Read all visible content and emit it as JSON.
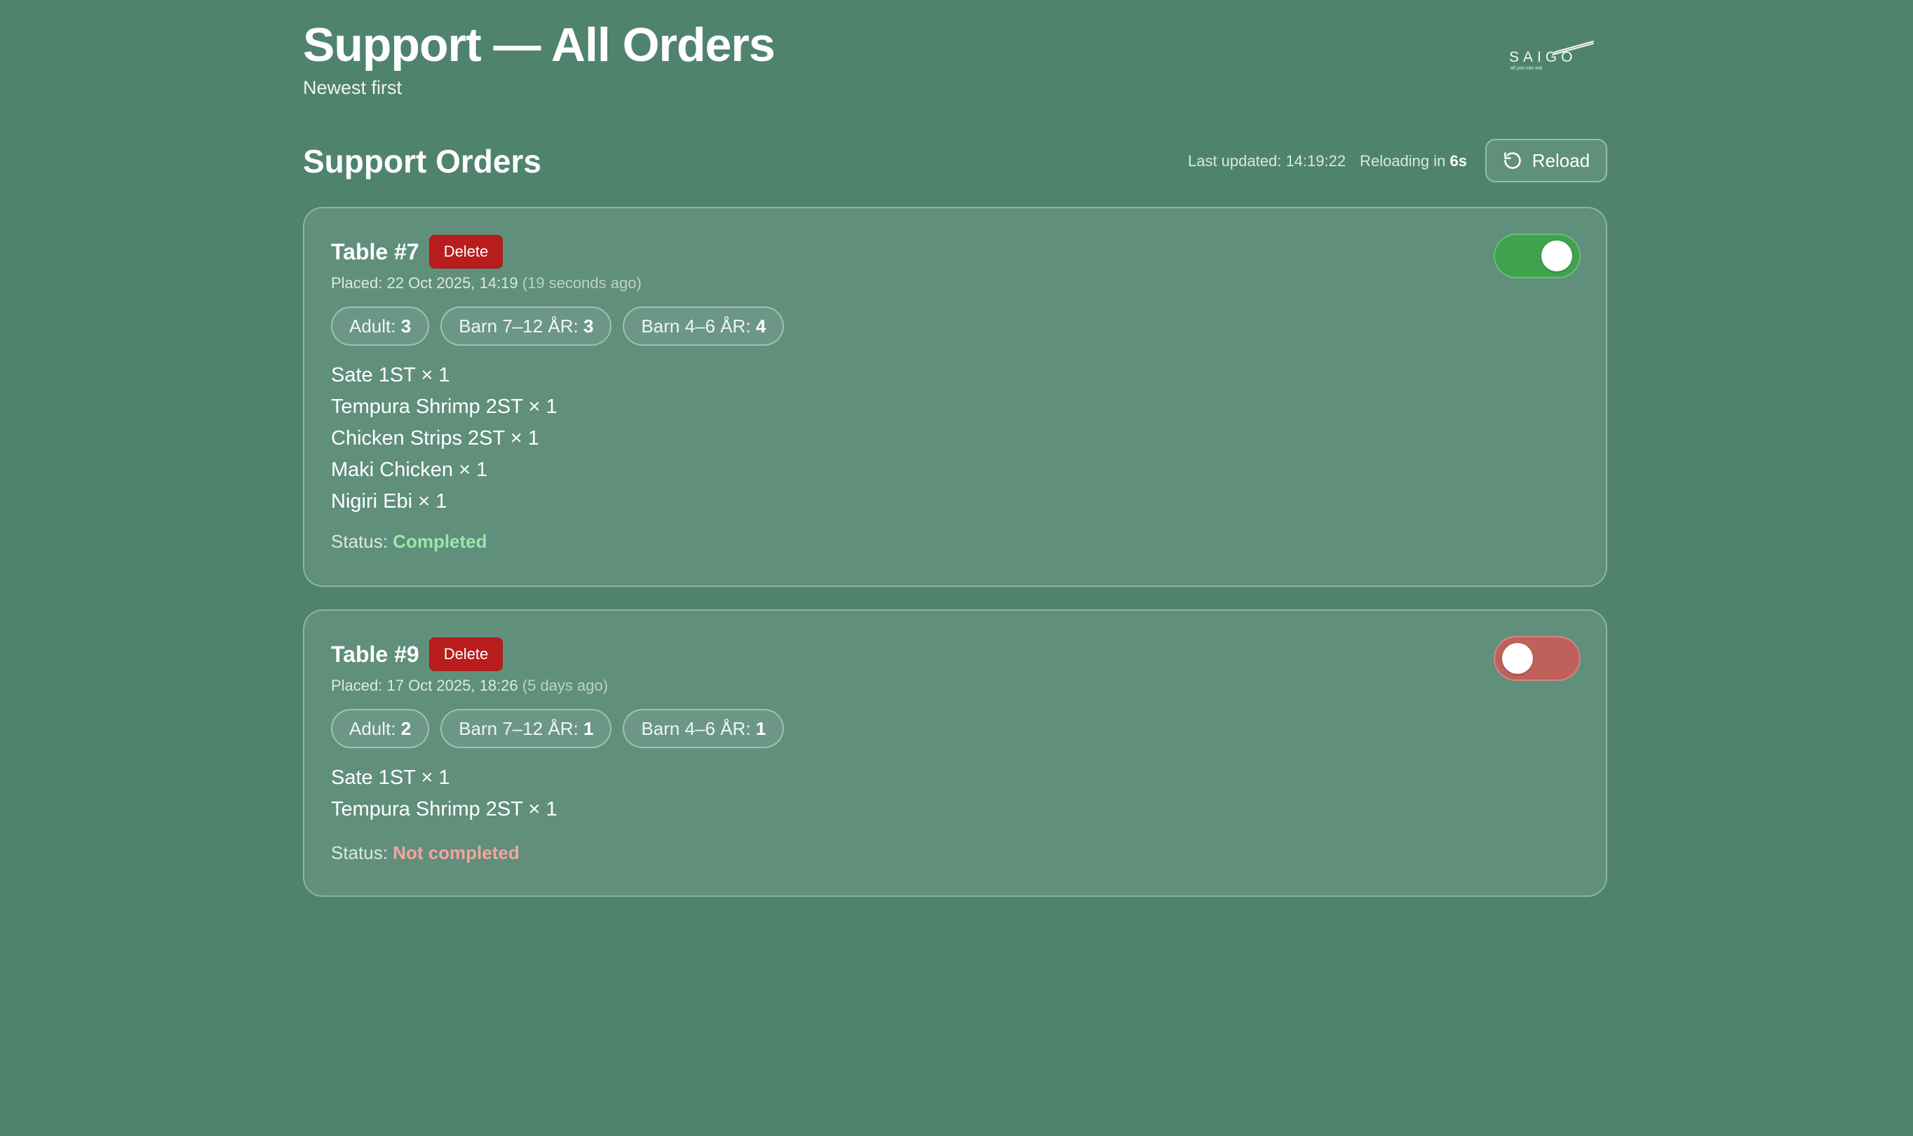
{
  "header": {
    "title": "Support — All Orders",
    "subtitle": "Newest first",
    "logo": {
      "word": "SAIGO",
      "tagline": "all you can eat"
    }
  },
  "section": {
    "title": "Support Orders",
    "last_updated_label": "Last updated:",
    "last_updated_value": "14:19:22",
    "reloading_label": "Reloading in",
    "reloading_value": "6s",
    "reload_label": "Reload",
    "reload_icon": "refresh-icon"
  },
  "colors": {
    "background": "#4f836e",
    "delete": "#b91c1c",
    "toggle_on": "#3fa34d",
    "toggle_off": "#c0605b",
    "status_completed": "#9be7a8",
    "status_not_completed": "#f6a3a0"
  },
  "orders": [
    {
      "title": "Table #7",
      "delete_label": "Delete",
      "placed_label": "Placed:",
      "placed_at": "22 Oct 2025, 14:19",
      "placed_ago": "(19 seconds ago)",
      "guests": [
        {
          "label": "Adult:",
          "count": "3"
        },
        {
          "label": "Barn 7–12 ÅR:",
          "count": "3"
        },
        {
          "label": "Barn 4–6 ÅR:",
          "count": "4"
        }
      ],
      "items": [
        "Sate 1ST × 1",
        "Tempura Shrimp 2ST × 1",
        "Chicken Strips 2ST × 1",
        "Maki Chicken × 1",
        "Nigiri Ebi × 1"
      ],
      "status_label": "Status:",
      "status": "Completed",
      "completed": true
    },
    {
      "title": "Table #9",
      "delete_label": "Delete",
      "placed_label": "Placed:",
      "placed_at": "17 Oct 2025, 18:26",
      "placed_ago": "(5 days ago)",
      "guests": [
        {
          "label": "Adult:",
          "count": "2"
        },
        {
          "label": "Barn 7–12 ÅR:",
          "count": "1"
        },
        {
          "label": "Barn 4–6 ÅR:",
          "count": "1"
        }
      ],
      "items": [
        "Sate 1ST × 1",
        "Tempura Shrimp 2ST × 1"
      ],
      "status_label": "Status:",
      "status": "Not completed",
      "completed": false
    }
  ]
}
